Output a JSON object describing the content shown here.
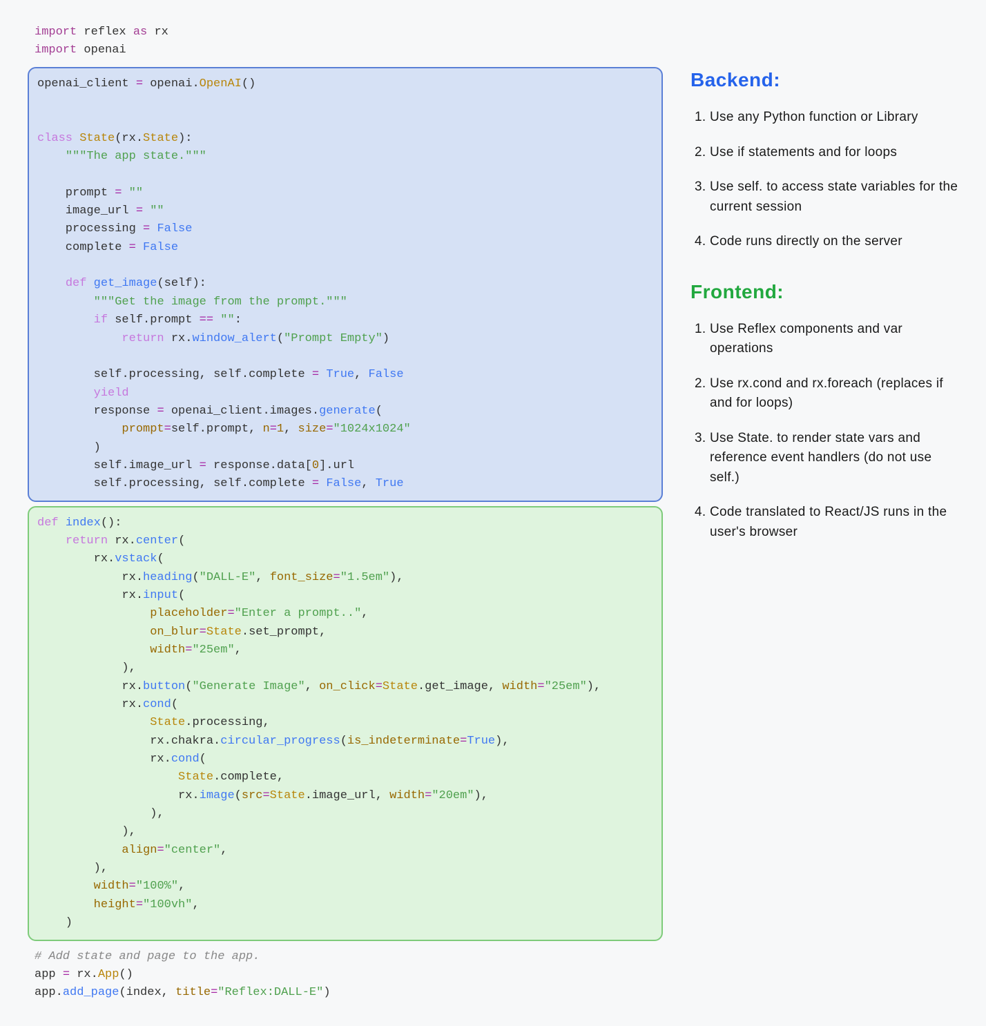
{
  "code": {
    "imports": "<span class=\"tk-imp\">import</span> reflex <span class=\"tk-imp\">as</span> rx\n<span class=\"tk-imp\">import</span> openai",
    "backend": "openai_client <span class=\"tk-op\">=</span> openai.<span class=\"tk-cls\">OpenAI</span>()\n\n\n<span class=\"tk-kw\">class</span> <span class=\"tk-cls\">State</span>(rx.<span class=\"tk-cls\">State</span>):\n    <span class=\"tk-doc\">\"\"\"The app state.\"\"\"</span>\n\n    prompt <span class=\"tk-op\">=</span> <span class=\"tk-str\">\"\"</span>\n    image_url <span class=\"tk-op\">=</span> <span class=\"tk-str\">\"\"</span>\n    processing <span class=\"tk-op\">=</span> <span class=\"tk-bool\">False</span>\n    complete <span class=\"tk-op\">=</span> <span class=\"tk-bool\">False</span>\n\n    <span class=\"tk-kw\">def</span> <span class=\"tk-fn\">get_image</span>(<span class=\"tk-self\">self</span>):\n        <span class=\"tk-doc\">\"\"\"Get the image from the prompt.\"\"\"</span>\n        <span class=\"tk-kw\">if</span> <span class=\"tk-self\">self</span>.prompt <span class=\"tk-op\">==</span> <span class=\"tk-str\">\"\"</span>:\n            <span class=\"tk-kw\">return</span> rx.<span class=\"tk-fn\">window_alert</span>(<span class=\"tk-str\">\"Prompt Empty\"</span>)\n\n        <span class=\"tk-self\">self</span>.processing, <span class=\"tk-self\">self</span>.complete <span class=\"tk-op\">=</span> <span class=\"tk-bool\">True</span>, <span class=\"tk-bool\">False</span>\n        <span class=\"tk-kw\">yield</span>\n        response <span class=\"tk-op\">=</span> openai_client.images.<span class=\"tk-fn\">generate</span>(\n            <span class=\"tk-prop\">prompt</span><span class=\"tk-op\">=</span><span class=\"tk-self\">self</span>.prompt, <span class=\"tk-prop\">n</span><span class=\"tk-op\">=</span><span class=\"tk-num\">1</span>, <span class=\"tk-prop\">size</span><span class=\"tk-op\">=</span><span class=\"tk-str\">\"1024x1024\"</span>\n        )\n        <span class=\"tk-self\">self</span>.image_url <span class=\"tk-op\">=</span> response.data[<span class=\"tk-num\">0</span>].url\n        <span class=\"tk-self\">self</span>.processing, <span class=\"tk-self\">self</span>.complete <span class=\"tk-op\">=</span> <span class=\"tk-bool\">False</span>, <span class=\"tk-bool\">True</span>",
    "frontend": "<span class=\"tk-kw\">def</span> <span class=\"tk-fn\">index</span>():\n    <span class=\"tk-kw\">return</span> rx.<span class=\"tk-fn\">center</span>(\n        rx.<span class=\"tk-fn\">vstack</span>(\n            rx.<span class=\"tk-fn\">heading</span>(<span class=\"tk-str\">\"DALL-E\"</span>, <span class=\"tk-prop\">font_size</span><span class=\"tk-op\">=</span><span class=\"tk-str\">\"1.5em\"</span>),\n            rx.<span class=\"tk-fn\">input</span>(\n                <span class=\"tk-prop\">placeholder</span><span class=\"tk-op\">=</span><span class=\"tk-str\">\"Enter a prompt..\"</span>,\n                <span class=\"tk-prop\">on_blur</span><span class=\"tk-op\">=</span><span class=\"tk-cls\">State</span>.set_prompt,\n                <span class=\"tk-prop\">width</span><span class=\"tk-op\">=</span><span class=\"tk-str\">\"25em\"</span>,\n            ),\n            rx.<span class=\"tk-fn\">button</span>(<span class=\"tk-str\">\"Generate Image\"</span>, <span class=\"tk-prop\">on_click</span><span class=\"tk-op\">=</span><span class=\"tk-cls\">State</span>.get_image, <span class=\"tk-prop\">width</span><span class=\"tk-op\">=</span><span class=\"tk-str\">\"25em\"</span>),\n            rx.<span class=\"tk-fn\">cond</span>(\n                <span class=\"tk-cls\">State</span>.processing,\n                rx.chakra.<span class=\"tk-fn\">circular_progress</span>(<span class=\"tk-prop\">is_indeterminate</span><span class=\"tk-op\">=</span><span class=\"tk-bool\">True</span>),\n                rx.<span class=\"tk-fn\">cond</span>(\n                    <span class=\"tk-cls\">State</span>.complete,\n                    rx.<span class=\"tk-fn\">image</span>(<span class=\"tk-prop\">src</span><span class=\"tk-op\">=</span><span class=\"tk-cls\">State</span>.image_url, <span class=\"tk-prop\">width</span><span class=\"tk-op\">=</span><span class=\"tk-str\">\"20em\"</span>),\n                ),\n            ),\n            <span class=\"tk-prop\">align</span><span class=\"tk-op\">=</span><span class=\"tk-str\">\"center\"</span>,\n        ),\n        <span class=\"tk-prop\">width</span><span class=\"tk-op\">=</span><span class=\"tk-str\">\"100%\"</span>,\n        <span class=\"tk-prop\">height</span><span class=\"tk-op\">=</span><span class=\"tk-str\">\"100vh\"</span>,\n    )",
    "footer": "<span class=\"tk-cmt\"># Add state and page to the app.</span>\napp <span class=\"tk-op\">=</span> rx.<span class=\"tk-cls\">App</span>()\napp.<span class=\"tk-fn\">add_page</span>(index, <span class=\"tk-prop\">title</span><span class=\"tk-op\">=</span><span class=\"tk-str\">\"Reflex:DALL-E\"</span>)"
  },
  "info": {
    "backend": {
      "title": "Backend:",
      "items": [
        "Use any Python function or Library",
        "Use if statements and for loops",
        "Use self. to access state variables for the current session",
        "Code runs directly on the server"
      ]
    },
    "frontend": {
      "title": "Frontend:",
      "items": [
        "Use Reflex components and var operations",
        "Use rx.cond and rx.foreach (replaces if and for loops)",
        "Use State. to render state vars and reference event handlers (do not use self.)",
        "Code translated to React/JS runs in the user's browser"
      ]
    }
  }
}
